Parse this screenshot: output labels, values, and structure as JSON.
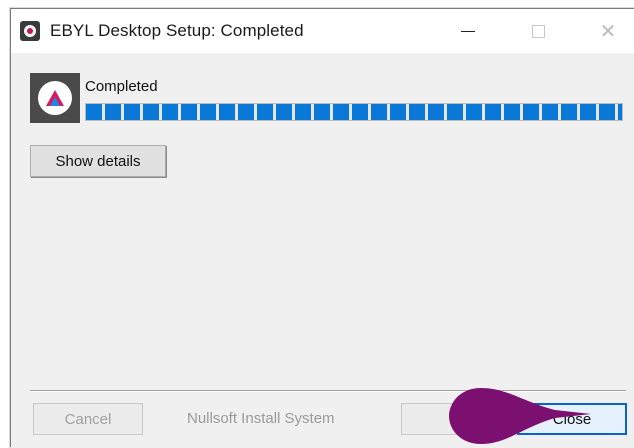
{
  "window": {
    "title": "EBYL Desktop Setup: Completed",
    "controls": {
      "minimize": "minimize-icon",
      "maximize": "maximize-icon",
      "close": "close-icon"
    }
  },
  "installer": {
    "status": "Completed",
    "progress_percent": 100,
    "show_details_label": "Show details",
    "brand_text": "Nullsoft Install System"
  },
  "footer": {
    "cancel_label": "Cancel",
    "back_label": "",
    "close_label": "Close"
  },
  "colors": {
    "progress": "#0a78d7",
    "pointer": "#7b1070",
    "close_border": "#0a64c8"
  }
}
